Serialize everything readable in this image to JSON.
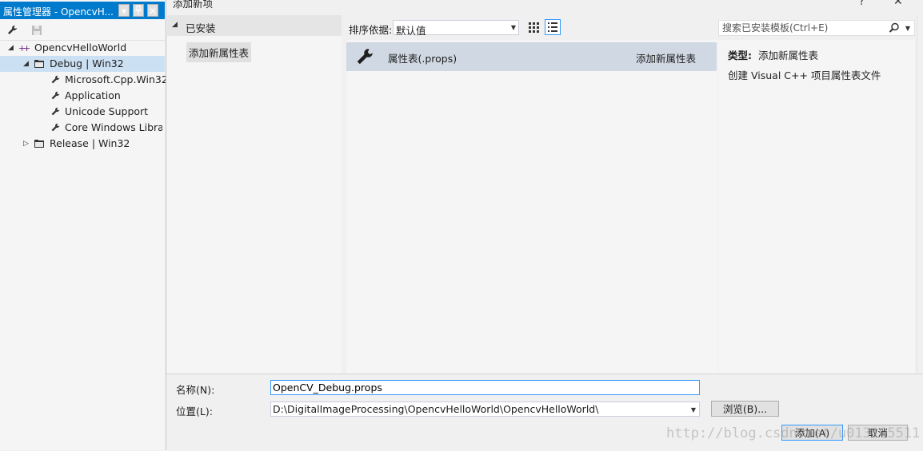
{
  "property_manager": {
    "title": "属性管理器 - OpencvH...",
    "tree": {
      "project": "OpencvHelloWorld",
      "debug_config": "Debug | Win32",
      "debug_children": [
        "Microsoft.Cpp.Win32",
        "Application",
        "Unicode Support",
        "Core Windows Librar"
      ],
      "release_config": "Release | Win32"
    }
  },
  "dialog": {
    "title": "添加新项",
    "help": "?",
    "categories": {
      "header": "已安装",
      "items": [
        "添加新属性表"
      ]
    },
    "sort": {
      "label": "排序依据:",
      "value": "默认值"
    },
    "search": {
      "placeholder": "搜索已安装模板(Ctrl+E)"
    },
    "templates": [
      {
        "name": "属性表(.props)",
        "type": "添加新属性表"
      }
    ],
    "description": {
      "type_label": "类型:",
      "type_value": "添加新属性表",
      "text": "创建 Visual C++ 项目属性表文件"
    },
    "form": {
      "name_label": "名称(N):",
      "name_value": "OpenCV_Debug.props",
      "location_label": "位置(L):",
      "location_value": "D:\\DigitalImageProcessing\\OpencvHelloWorld\\OpencvHelloWorld\\"
    },
    "buttons": {
      "browse": "浏览(B)...",
      "add": "添加(A)",
      "cancel": "取消"
    }
  },
  "watermark": "http://blog.csdn.net/u013105511",
  "colors": {
    "accent": "#007acc",
    "selection": "#cce0f3",
    "template_selected": "#cfd8e3"
  }
}
